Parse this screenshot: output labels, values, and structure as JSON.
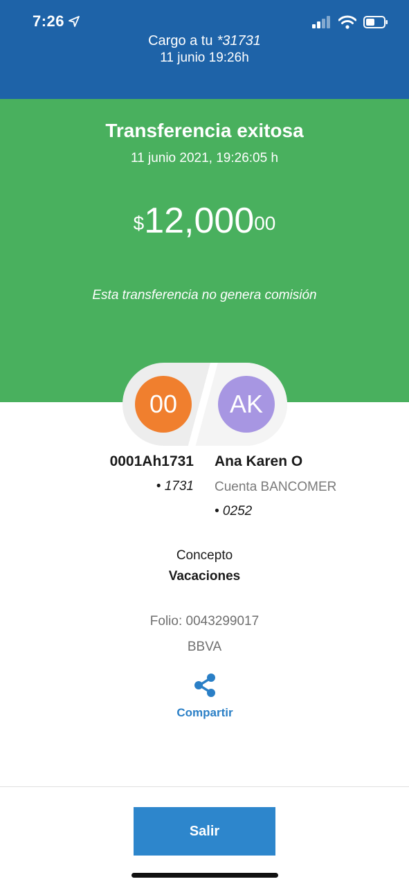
{
  "status_bar": {
    "time": "7:26",
    "icons": [
      "location-arrow-icon",
      "cellular-signal-icon",
      "wifi-icon",
      "battery-icon"
    ]
  },
  "header": {
    "charge_label": "Cargo a tu",
    "account_masked": "*31731",
    "date": "11 junio 19:26h"
  },
  "transfer": {
    "title": "Transferencia exitosa",
    "datetime": "11 junio 2021, 19:26:05 h",
    "amount": {
      "currency_symbol": "$",
      "integer": "12,000",
      "cents": "00"
    },
    "commission_note": "Esta transferencia no genera comisión"
  },
  "origin": {
    "initials": "00",
    "name": "0001Ah1731",
    "account_suffix": "• 1731"
  },
  "destination": {
    "initials": "AK",
    "name": "Ana Karen O",
    "bank_account": "Cuenta BANCOMER",
    "account_suffix": "• 0252"
  },
  "concept": {
    "label": "Concepto",
    "value": "Vacaciones"
  },
  "folio": "Folio: 0043299017",
  "bank": "BBVA",
  "share": {
    "label": "Compartir",
    "icon": "share-icon"
  },
  "footer": {
    "exit_label": "Salir"
  },
  "colors": {
    "header_blue": "#1e63a8",
    "success_green": "#49b05e",
    "origin_avatar": "#f07f2e",
    "dest_avatar": "#a796e2",
    "accent_blue": "#2a7fc6",
    "button_blue": "#2d86cc"
  }
}
